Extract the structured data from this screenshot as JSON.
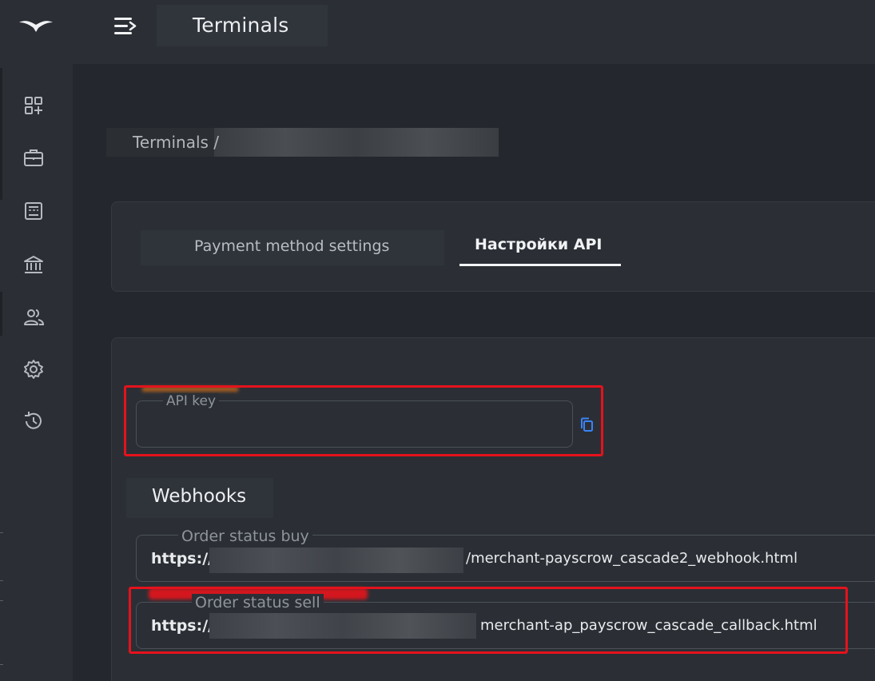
{
  "header": {
    "title": "Terminals"
  },
  "sidebar": {
    "items": [
      {
        "name": "dashboard",
        "icon": "dashboard-grid-icon"
      },
      {
        "name": "briefcase",
        "icon": "briefcase-icon"
      },
      {
        "name": "terminal",
        "icon": "terminal-window-icon"
      },
      {
        "name": "bank",
        "icon": "bank-icon"
      },
      {
        "name": "users",
        "icon": "users-icon"
      },
      {
        "name": "settings",
        "icon": "gear-icon"
      },
      {
        "name": "history",
        "icon": "history-icon"
      }
    ]
  },
  "breadcrumb": {
    "root": "Terminals /"
  },
  "tabs": {
    "payment_label": "Payment method settings",
    "api_label": "Настройки API",
    "active": "api"
  },
  "api_key": {
    "label": "API key",
    "value": ""
  },
  "webhooks": {
    "title": "Webhooks",
    "buy": {
      "label": "Order status buy",
      "prefix": "https://",
      "suffix": "/merchant-payscrow_cascade2_webhook.html"
    },
    "sell": {
      "label": "Order status sell",
      "prefix": "https://",
      "suffix": "merchant-ap_payscrow_cascade_callback.html"
    }
  },
  "colors": {
    "background": "#24272d",
    "panel": "#2b2f35",
    "highlight": "#e5121c",
    "copy_icon": "#3b82f6"
  }
}
